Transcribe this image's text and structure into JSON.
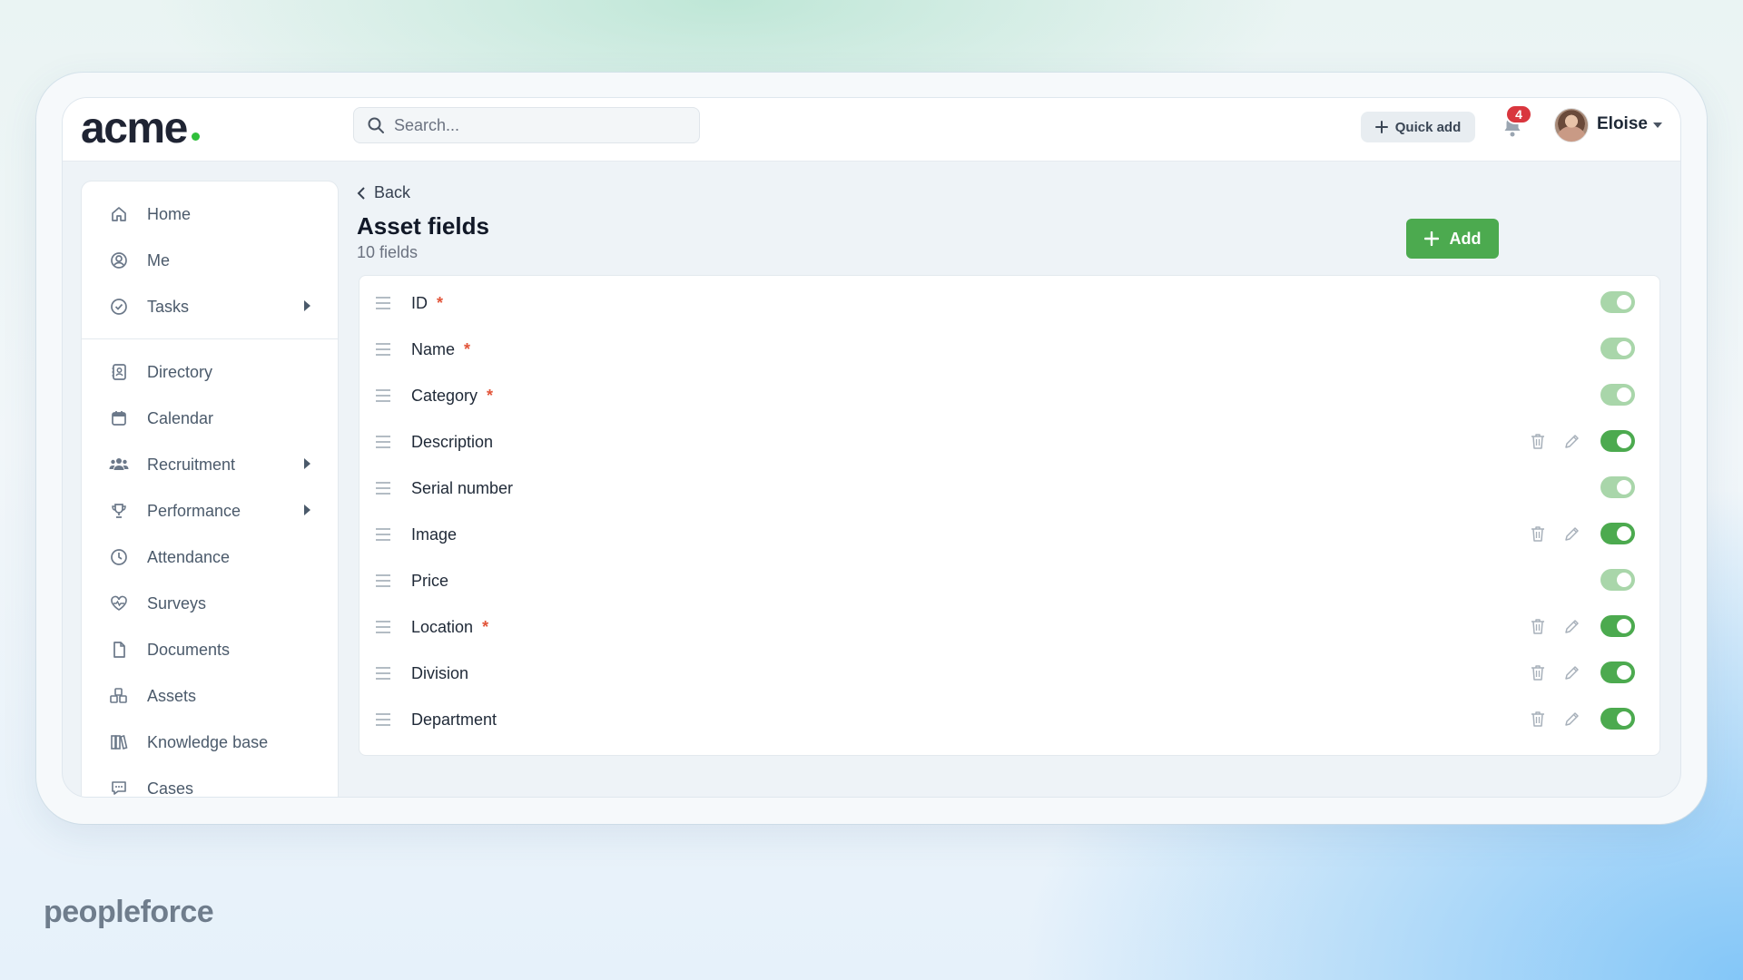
{
  "app": {
    "logo": "acme",
    "search_placeholder": "Search...",
    "quick_add": "Quick add",
    "notifications_count": "4",
    "user_name": "Eloise"
  },
  "sidebar": {
    "items": [
      {
        "label": "Home",
        "icon": "home-icon"
      },
      {
        "label": "Me",
        "icon": "user-circle-icon"
      },
      {
        "label": "Tasks",
        "icon": "check-circle-icon",
        "has_submenu": true
      },
      {
        "label": "Directory",
        "icon": "contact-book-icon"
      },
      {
        "label": "Calendar",
        "icon": "calendar-icon"
      },
      {
        "label": "Recruitment",
        "icon": "people-icon",
        "has_submenu": true
      },
      {
        "label": "Performance",
        "icon": "trophy-icon",
        "has_submenu": true
      },
      {
        "label": "Attendance",
        "icon": "clock-icon"
      },
      {
        "label": "Surveys",
        "icon": "heart-pulse-icon"
      },
      {
        "label": "Documents",
        "icon": "document-icon"
      },
      {
        "label": "Assets",
        "icon": "cubes-icon"
      },
      {
        "label": "Knowledge base",
        "icon": "books-icon"
      },
      {
        "label": "Cases",
        "icon": "chat-icon"
      }
    ]
  },
  "page": {
    "back_label": "Back",
    "title": "Asset fields",
    "subtitle": "10 fields",
    "add_label": "Add"
  },
  "fields": [
    {
      "name": "ID",
      "required": "*",
      "editable": false
    },
    {
      "name": "Name",
      "required": "*",
      "editable": false
    },
    {
      "name": "Category",
      "required": "*",
      "editable": false
    },
    {
      "name": "Description",
      "required": "",
      "editable": true
    },
    {
      "name": "Serial number",
      "required": "",
      "editable": false
    },
    {
      "name": "Image",
      "required": "",
      "editable": true
    },
    {
      "name": "Price",
      "required": "",
      "editable": false
    },
    {
      "name": "Location",
      "required": "*",
      "editable": true
    },
    {
      "name": "Division",
      "required": "",
      "editable": true
    },
    {
      "name": "Department",
      "required": "",
      "editable": true
    }
  ],
  "colors": {
    "accent_green": "#4caa4f",
    "toggle_disabled": "#a9d6aa",
    "required_mark": "#e2553a",
    "badge_red": "#d9363e"
  },
  "branding": {
    "footer_logo": "peopleforce"
  }
}
